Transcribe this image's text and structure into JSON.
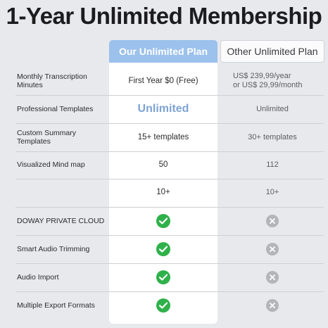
{
  "title": "1-Year Unlimited Membership",
  "columns": {
    "ours": "Our Unlimited Plan",
    "other": "Other Unlimited Plan"
  },
  "rows": [
    {
      "feature": "Monthly Transcription Minutes",
      "ours": "First Year $0 (Free)",
      "other_line1": "US$ 239,99/year",
      "other_line2": "or US$ 29,99/month"
    },
    {
      "feature": "Professional Templates",
      "ours": "Unlimited",
      "other": "Unlimited"
    },
    {
      "feature": "Custom Summary Templates",
      "ours": "15+ templates",
      "other": "30+ templates"
    },
    {
      "feature": "Visualized Mind map",
      "ours": "50",
      "other": "112"
    },
    {
      "feature": "",
      "ours": "10+",
      "other": "10+"
    },
    {
      "feature": "DOWAY PRIVATE CLOUD",
      "ours_icon": "check-icon",
      "other_icon": "cross-icon"
    },
    {
      "feature": "Smart Audio Trimming",
      "ours_icon": "check-icon",
      "other_icon": "cross-icon"
    },
    {
      "feature": "Audio Import",
      "ours_icon": "check-icon",
      "other_icon": "cross-icon"
    },
    {
      "feature": "Multiple Export Formats",
      "ours_icon": "check-icon",
      "other_icon": "cross-icon"
    }
  ],
  "colors": {
    "background": "#e8e9ed",
    "accent": "#9bc1ec",
    "unlimited_text": "#7ea3d4",
    "check": "#2fb14a",
    "cross": "#b4b5b9"
  }
}
